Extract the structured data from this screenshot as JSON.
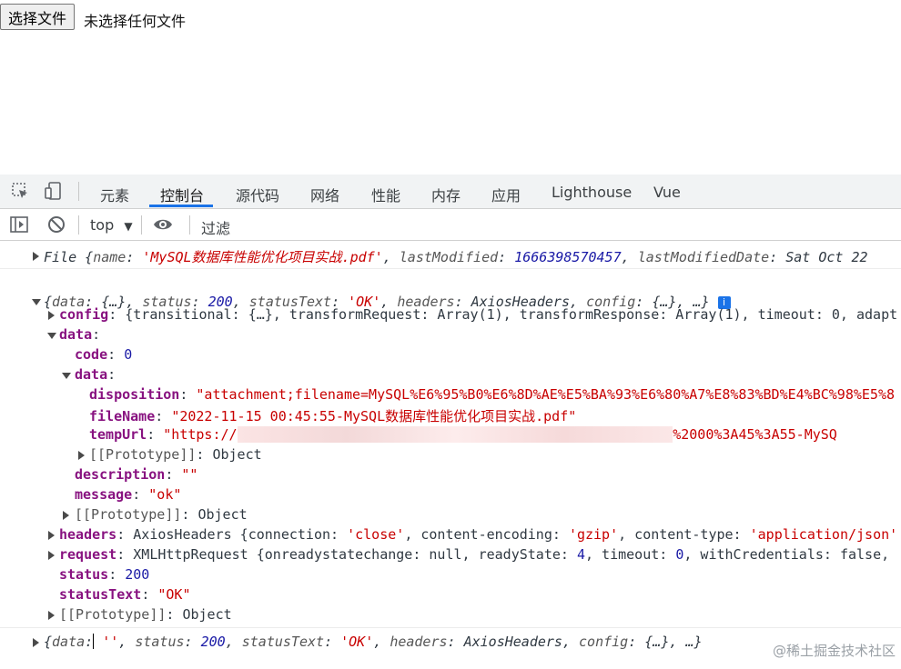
{
  "page": {
    "file_button": "选择文件",
    "file_status": "未选择任何文件"
  },
  "devtools": {
    "tabs": [
      "元素",
      "控制台",
      "源代码",
      "网络",
      "性能",
      "内存",
      "应用",
      "Lighthouse",
      "Vue"
    ],
    "active_tab": "控制台",
    "context": "top",
    "filter_placeholder": "过滤"
  },
  "console": {
    "line1": {
      "prefix": "File {",
      "k_name": "name",
      "v_name": "'MySQL数据库性能优化项目实战.pdf'",
      "k_lastModified": "lastModified",
      "v_lastModified": "1666398570457",
      "k_lastModifiedDate": "lastModifiedDate",
      "v_lastModifiedDate": "Sat Oct 22"
    },
    "response": {
      "summary_open": "{",
      "k_data": "data",
      "v_data": "{…}",
      "k_status": "status",
      "v_status": "200",
      "k_statusText": "statusText",
      "v_statusText": "'OK'",
      "k_headers": "headers",
      "v_headers": "AxiosHeaders",
      "k_config": "config",
      "v_config": "{…}",
      "summary_tail": "…}",
      "info": "i",
      "config_key": "config",
      "config_val": "{transitional: {…}, transformRequest: Array(1), transformResponse: Array(1), timeout: 0, adapt",
      "data_key": "data",
      "code_key": "code",
      "code_val": "0",
      "inner_data_key": "data",
      "disposition_key": "disposition",
      "disposition_val": "\"attachment;filename=MySQL%E6%95%B0%E6%8D%AE%E5%BA%93%E6%80%A7%E8%83%BD%E4%BC%98%E5%8",
      "fileName_key": "fileName",
      "fileName_val": "\"2022-11-15 00:45:55-MySQL数据库性能优化项目实战.pdf\"",
      "tempUrl_key": "tempUrl",
      "tempUrl_prefix": "\"https://",
      "tempUrl_suffix": "%2000%3A45%3A55-MySQ",
      "proto_key": "[[Prototype]]",
      "proto_val": "Object",
      "description_key": "description",
      "description_val": "\"\"",
      "message_key": "message",
      "message_val": "\"ok\"",
      "headers_key": "headers",
      "headers_val_a": "AxiosHeaders {connection: ",
      "headers_s1": "'close'",
      "headers_val_b": ", content-encoding: ",
      "headers_s2": "'gzip'",
      "headers_val_c": ", content-type: ",
      "headers_s3": "'application/json'",
      "request_key": "request",
      "request_val_a": "XMLHttpRequest {onreadystatechange: null, readyState: ",
      "request_n1": "4",
      "request_val_b": ", timeout: ",
      "request_n2": "0",
      "request_val_c": ", withCredentials: false,",
      "status_key": "status",
      "status_val": "200",
      "statusText_key": "statusText",
      "statusText_val": "\"OK\""
    },
    "last_line": {
      "open": "{",
      "k_data": "data",
      "v_data": "''",
      "k_status": "status",
      "v_status": "200",
      "k_statusText": "statusText",
      "v_statusText": "'OK'",
      "k_headers": "headers",
      "v_headers": "AxiosHeaders",
      "k_config": "config",
      "v_config": "{…}",
      "tail": "…}"
    }
  },
  "watermark": "@稀土掘金技术社区"
}
